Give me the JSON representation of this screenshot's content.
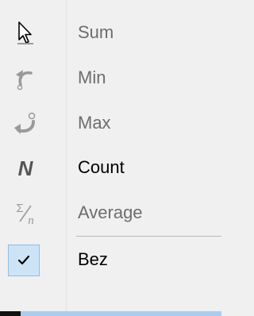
{
  "menu": {
    "items": [
      {
        "label": "Sum",
        "icon": "sum-cursor-icon",
        "enabled": false
      },
      {
        "label": "Min",
        "icon": "undo-arrow-icon",
        "enabled": false
      },
      {
        "label": "Max",
        "icon": "redo-arrow-icon",
        "enabled": false
      },
      {
        "label": "Count",
        "icon": "n-letter-icon",
        "enabled": true
      },
      {
        "label": "Average",
        "icon": "sigma-divide-icon",
        "enabled": false
      }
    ],
    "checked_item": {
      "label": "Bez",
      "icon": "checkmark-icon",
      "checked": true
    }
  },
  "colors": {
    "disabled_text": "#6d6d6d",
    "enabled_text": "#000000",
    "check_bg": "#cde4f7",
    "check_border": "#8ebde6",
    "bottom_bar": "#a8cdf0"
  }
}
